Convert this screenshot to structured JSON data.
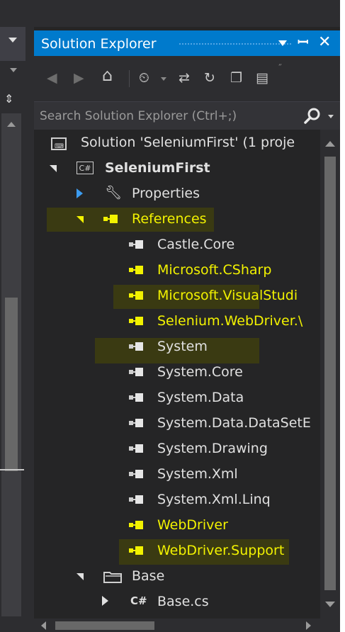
{
  "solution_explorer": {
    "title": "Solution Explorer",
    "search": {
      "placeholder": "Search Solution Explorer (Ctrl+;)"
    },
    "tree": {
      "solution_label": "Solution 'SeleniumFirst' (1 proje",
      "project_label": "SeleniumFirst",
      "project_badge": "C#",
      "properties_label": "Properties",
      "references_label": "References",
      "references": [
        {
          "label": "Castle.Core",
          "highlighted": false
        },
        {
          "label": "Microsoft.CSharp",
          "highlighted": true
        },
        {
          "label": "Microsoft.VisualStudi",
          "highlighted": true
        },
        {
          "label": "Selenium.WebDriver.\\",
          "highlighted": true
        },
        {
          "label": "System",
          "highlighted": false
        },
        {
          "label": "System.Core",
          "highlighted": false
        },
        {
          "label": "System.Data",
          "highlighted": false
        },
        {
          "label": "System.Data.DataSetE",
          "highlighted": false
        },
        {
          "label": "System.Drawing",
          "highlighted": false
        },
        {
          "label": "System.Xml",
          "highlighted": false
        },
        {
          "label": "System.Xml.Linq",
          "highlighted": false
        },
        {
          "label": "WebDriver",
          "highlighted": true
        },
        {
          "label": "WebDriver.Support",
          "highlighted": true
        }
      ],
      "folder_label": "Base",
      "file_label": "Base.cs",
      "file_badge": "C#"
    }
  },
  "colors": {
    "accent": "#007acc",
    "highlight_text": "#f2f200",
    "panel_bg": "#252526"
  }
}
